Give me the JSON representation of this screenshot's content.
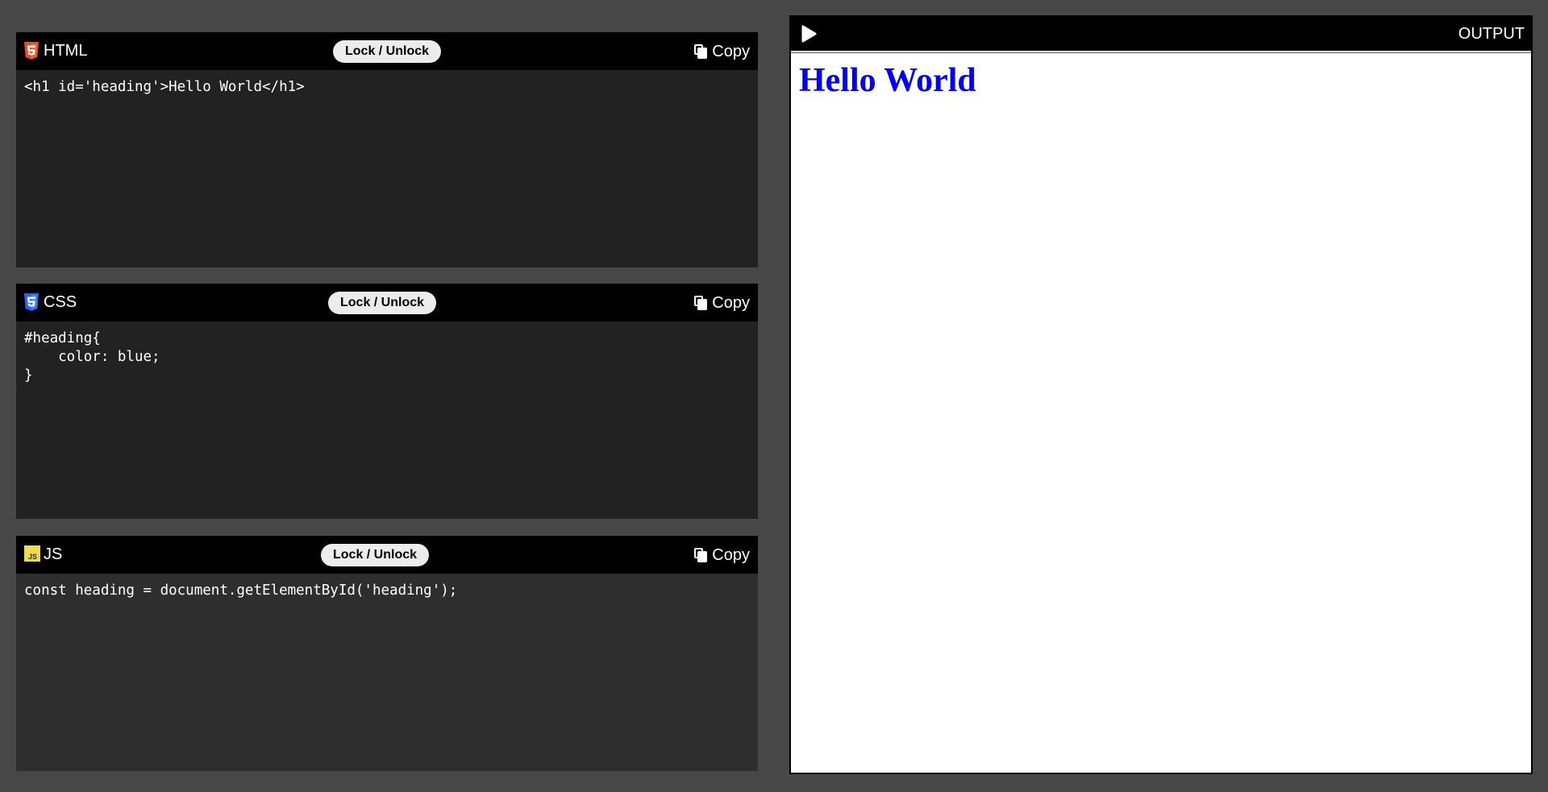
{
  "panels": {
    "html": {
      "title": "HTML",
      "icon": "html5-icon",
      "lock_label": "Lock / Unlock",
      "copy_label": "Copy",
      "code": "<h1 id='heading'>Hello World</h1>"
    },
    "css": {
      "title": "CSS",
      "icon": "css3-icon",
      "lock_label": "Lock / Unlock",
      "copy_label": "Copy",
      "code": "#heading{\n    color: blue;\n}"
    },
    "js": {
      "title": "JS",
      "icon": "js-icon",
      "lock_label": "Lock / Unlock",
      "copy_label": "Copy",
      "code": "const heading = document.getElementById('heading');"
    }
  },
  "output": {
    "title": "OUTPUT",
    "run_icon": "play-icon",
    "heading_text": "Hello World",
    "heading_color": "#0000ff"
  },
  "colors": {
    "page_background": "#474747",
    "header_background": "#000000",
    "editor_background": "#222222",
    "html_icon": "#e44d26",
    "css_icon": "#2965f1",
    "js_icon": "#f0db4f"
  }
}
